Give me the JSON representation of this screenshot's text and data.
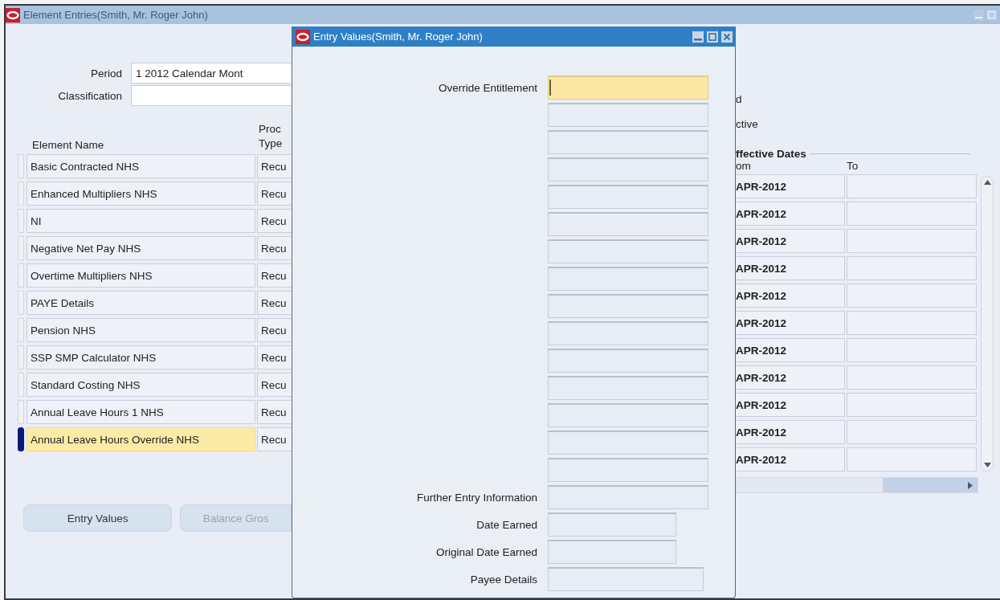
{
  "main_window": {
    "title": "Element Entries(Smith, Mr. Roger John)",
    "period": {
      "label": "Period",
      "value": "1 2012 Calendar Mont"
    },
    "classification": {
      "label": "Classification"
    },
    "right_fragments": [
      "d",
      "ctive"
    ],
    "table": {
      "name_header": "Element Name",
      "type_header": [
        "Proc",
        "Type"
      ],
      "dates_group": "ffective Dates",
      "from_header": "om",
      "to_header": "To",
      "rows": [
        {
          "name": "Basic Contracted NHS",
          "type": "Recu",
          "from": "APR-2012",
          "selected": false
        },
        {
          "name": "Enhanced Multipliers NHS",
          "type": "Recu",
          "from": "APR-2012",
          "selected": false
        },
        {
          "name": "NI",
          "type": "Recu",
          "from": "APR-2012",
          "selected": false
        },
        {
          "name": "Negative Net Pay NHS",
          "type": "Recu",
          "from": "APR-2012",
          "selected": false
        },
        {
          "name": "Overtime Multipliers NHS",
          "type": "Recu",
          "from": "APR-2012",
          "selected": false
        },
        {
          "name": "PAYE Details",
          "type": "Recu",
          "from": "APR-2012",
          "selected": false
        },
        {
          "name": "Pension NHS",
          "type": "Recu",
          "from": "APR-2012",
          "selected": false
        },
        {
          "name": "SSP SMP Calculator NHS",
          "type": "Recu",
          "from": "APR-2012",
          "selected": false
        },
        {
          "name": "Standard Costing NHS",
          "type": "Recu",
          "from": "APR-2012",
          "selected": false
        },
        {
          "name": "Annual Leave Hours 1 NHS",
          "type": "Recu",
          "from": "APR-2012",
          "selected": false
        },
        {
          "name": "Annual Leave Hours Override NHS",
          "type": "Recu",
          "from": "APR-2012",
          "selected": true
        }
      ]
    },
    "buttons": [
      {
        "label": "Entry Values",
        "disabled": false
      },
      {
        "label": "Balance Gros",
        "disabled": true
      }
    ]
  },
  "dialog": {
    "title": "Entry Values(Smith, Mr. Roger John)",
    "fields": [
      {
        "label": "Override Entitlement",
        "kind": "entry",
        "focused": true
      },
      {
        "kind": "entry",
        "focused": false
      },
      {
        "kind": "entry",
        "focused": false
      },
      {
        "kind": "entry",
        "focused": false
      },
      {
        "kind": "entry",
        "focused": false
      },
      {
        "kind": "entry",
        "focused": false
      },
      {
        "kind": "entry",
        "focused": false
      },
      {
        "kind": "entry",
        "focused": false
      },
      {
        "kind": "entry",
        "focused": false
      },
      {
        "kind": "entry",
        "focused": false
      },
      {
        "kind": "entry",
        "focused": false
      },
      {
        "kind": "entry",
        "focused": false
      },
      {
        "kind": "entry",
        "focused": false
      },
      {
        "kind": "entry",
        "focused": false
      },
      {
        "kind": "entry",
        "focused": false
      },
      {
        "label": "Further Entry Information",
        "kind": "entry",
        "focused": false
      },
      {
        "label": "Date Earned",
        "kind": "date",
        "focused": false
      },
      {
        "label": "Original Date Earned",
        "kind": "date",
        "focused": false
      },
      {
        "label": "Payee Details",
        "kind": "lookup",
        "focused": false
      }
    ]
  }
}
